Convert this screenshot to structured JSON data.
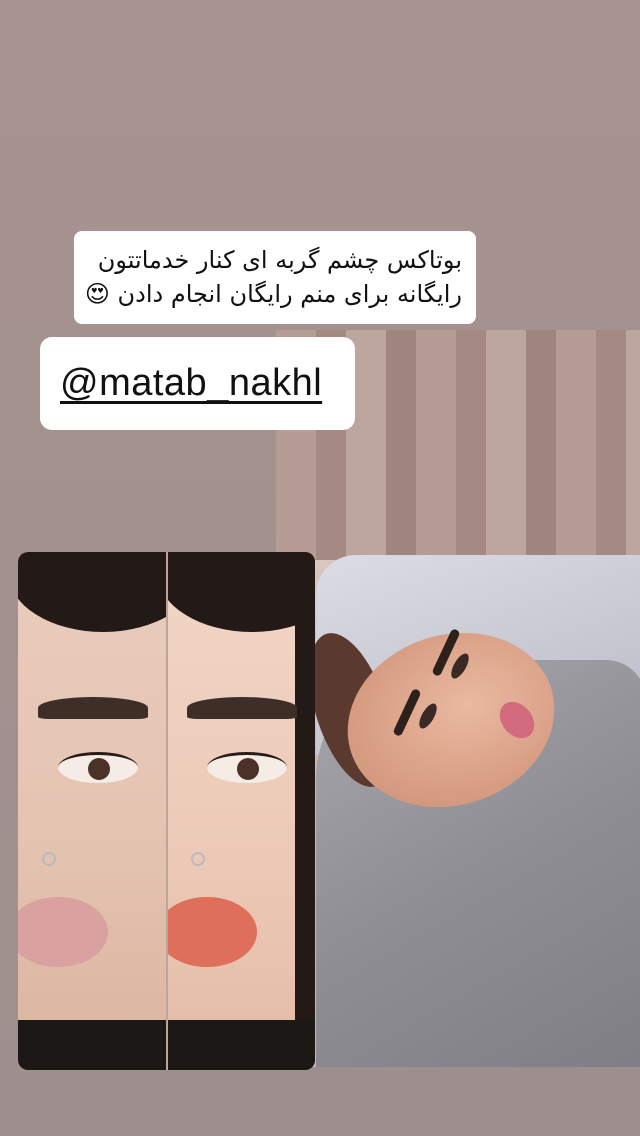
{
  "caption": {
    "line1": "بوتاکس چشم گربه ای کنار خدماتتون",
    "line2": "رایگانه برای منم رایگان انجام دادن 😍"
  },
  "mention": {
    "handle": "@matab_nakhl"
  },
  "photos": {
    "before_after": "before-after-eyebrow-comparison",
    "client": "client-on-treatment-chair"
  },
  "colors": {
    "background": "#a5928f",
    "sticker": "#ffffff"
  }
}
